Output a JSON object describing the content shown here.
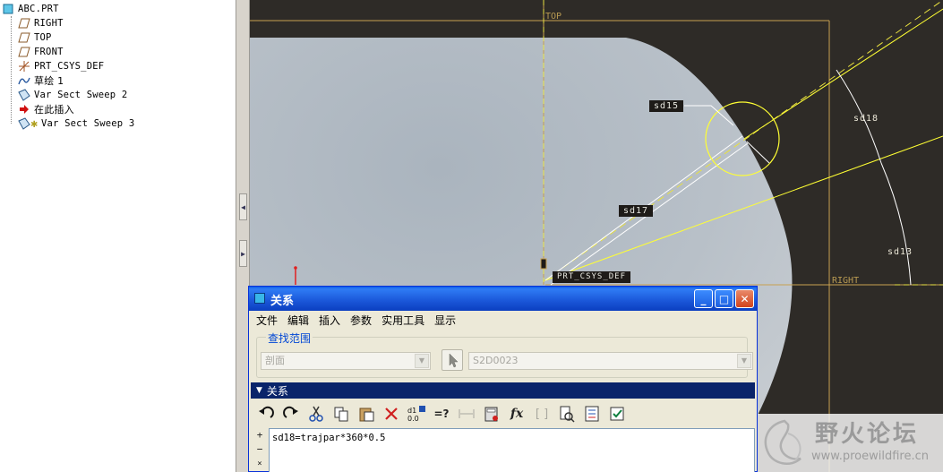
{
  "model_tree": {
    "items": [
      {
        "label": "ABC.PRT",
        "icon": "part-icon",
        "cn": false
      },
      {
        "label": "RIGHT",
        "icon": "datum-plane-icon",
        "cn": false
      },
      {
        "label": "TOP",
        "icon": "datum-plane-icon",
        "cn": false
      },
      {
        "label": "FRONT",
        "icon": "datum-plane-icon",
        "cn": false
      },
      {
        "label": "PRT_CSYS_DEF",
        "icon": "csys-icon",
        "cn": false
      },
      {
        "label": "草绘 1",
        "icon": "sketch-icon",
        "cn": true
      },
      {
        "label": "Var Sect Sweep 2",
        "icon": "sweep-icon",
        "cn": false
      },
      {
        "label": "在此插入",
        "icon": "insert-here-icon",
        "cn": true
      },
      {
        "label": "Var Sect Sweep 3",
        "icon": "sweep-active-icon",
        "cn": false
      }
    ]
  },
  "viewport": {
    "plane_top": "TOP",
    "plane_right": "RIGHT",
    "csys": "PRT_CSYS_DEF",
    "dims": {
      "sd15": "sd15",
      "sd17": "sd17",
      "sd18": "sd18",
      "sd13": "sd13"
    }
  },
  "dialog": {
    "title": "关系",
    "menu": [
      "文件",
      "编辑",
      "插入",
      "参数",
      "实用工具",
      "显示"
    ],
    "scope_title": "查找范围",
    "scope_type": "剖面",
    "scope_object": "S2D0023",
    "section_title": "关系",
    "relation_text": "sd18=trajpar*360*0.5",
    "gutter": [
      "+",
      "−",
      "×"
    ]
  },
  "watermark": {
    "title": "野火论坛",
    "url": "www.proewildfire.cn"
  },
  "colors": {
    "accent_blue": "#0a246a",
    "viewport_bg": "#2e2b27",
    "sketch_yellow": "#ffff33",
    "datum_gold": "#c8a050",
    "model_gray": "#b4bcc4"
  }
}
